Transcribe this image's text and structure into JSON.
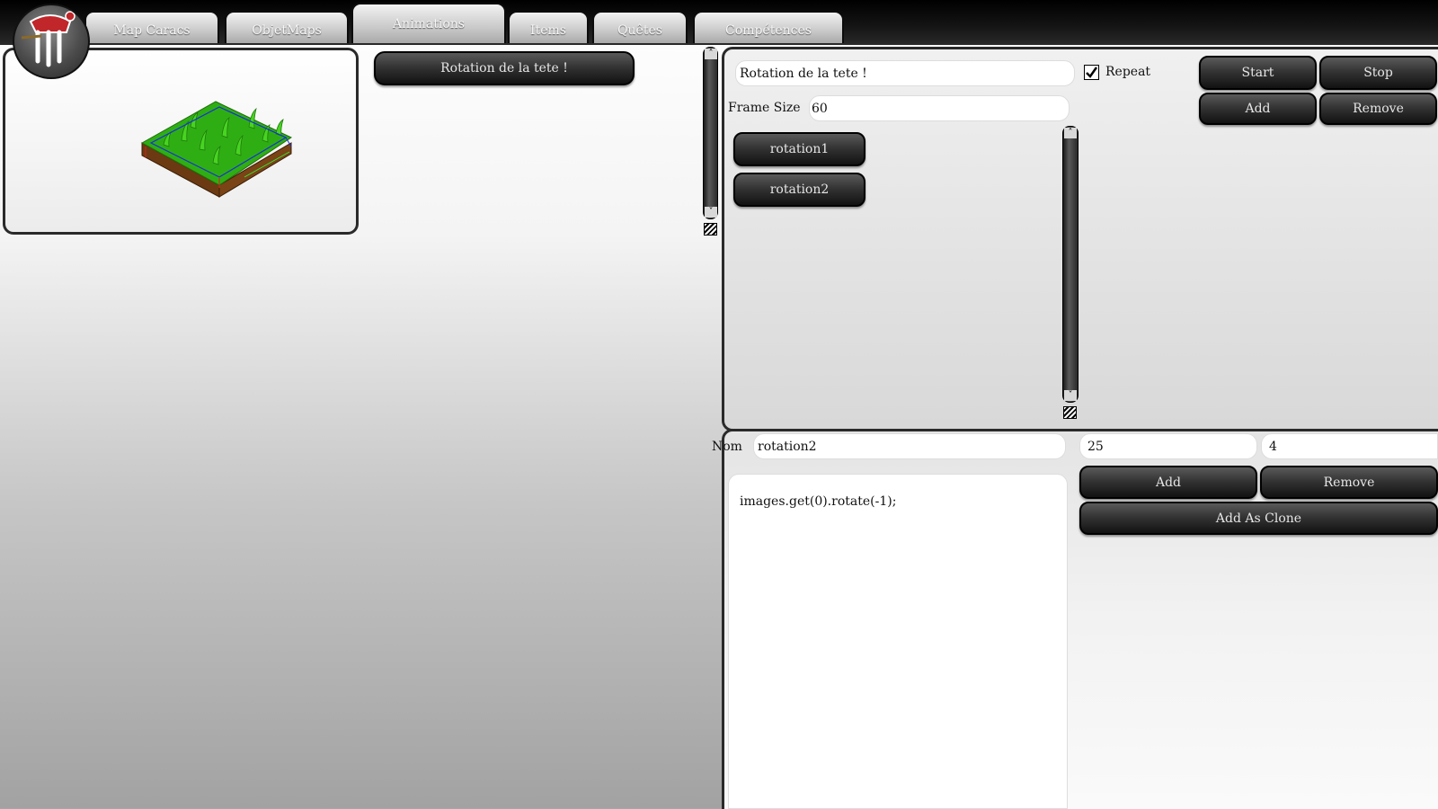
{
  "tabs": [
    {
      "label": "Map Caracs"
    },
    {
      "label": "ObjetMaps"
    },
    {
      "label": "Animations"
    },
    {
      "label": "Items"
    },
    {
      "label": "Quêtes"
    },
    {
      "label": "Compétences"
    }
  ],
  "active_tab": "Animations",
  "animation_list": [
    "Rotation de la tete !"
  ],
  "animation_editor": {
    "name_value": "Rotation de la tete !",
    "repeat_label": "Repeat",
    "repeat_checked": true,
    "frame_size_label": "Frame Size",
    "frame_size_value": "60",
    "frames": [
      "rotation1",
      "rotation2"
    ],
    "buttons": {
      "start": "Start",
      "stop": "Stop",
      "add": "Add",
      "remove": "Remove"
    }
  },
  "frame_editor": {
    "nom_label": "Nom",
    "nom_value": "rotation2",
    "field_a_value": "25",
    "field_b_value": "4",
    "code": "images.get(0).rotate(-1);",
    "buttons": {
      "add": "Add",
      "remove": "Remove",
      "add_as_clone": "Add As Clone"
    }
  },
  "colors": {
    "accent_dark": "#121212",
    "tile_green": "#2fae14",
    "tile_dirt": "#6b3a12"
  }
}
